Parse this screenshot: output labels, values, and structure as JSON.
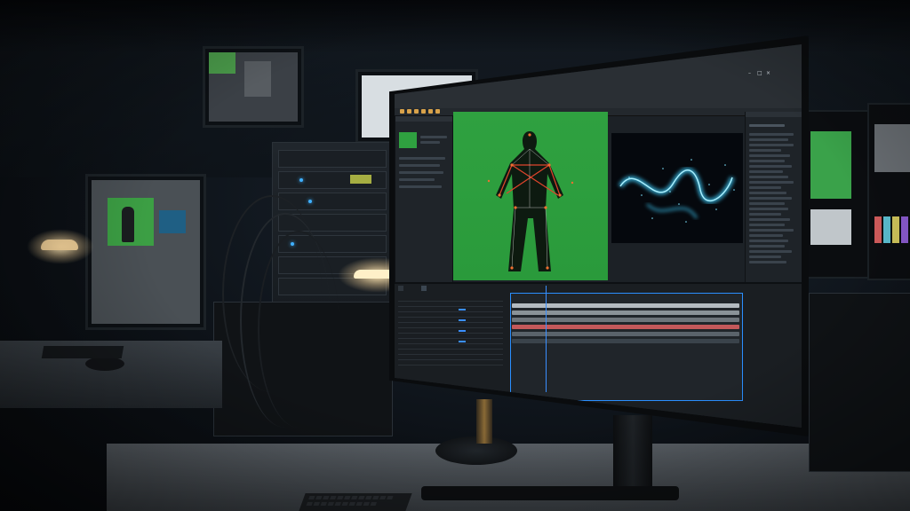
{
  "scene": {
    "description_label": "",
    "main_monitor": {
      "app_title": "",
      "viewer": {
        "left_label": "",
        "right_label": ""
      },
      "timeline": {
        "tabs": [
          "",
          ""
        ]
      }
    }
  },
  "colors": {
    "chroma_green": "#2fa140",
    "particle_cyan": "#3fd0ff",
    "pose_overlay": "#e0452c",
    "track_red": "#c4585a",
    "track_white": "#cfd6dc"
  },
  "icons": [
    "close-icon",
    "minimize-icon",
    "maximize-icon"
  ]
}
